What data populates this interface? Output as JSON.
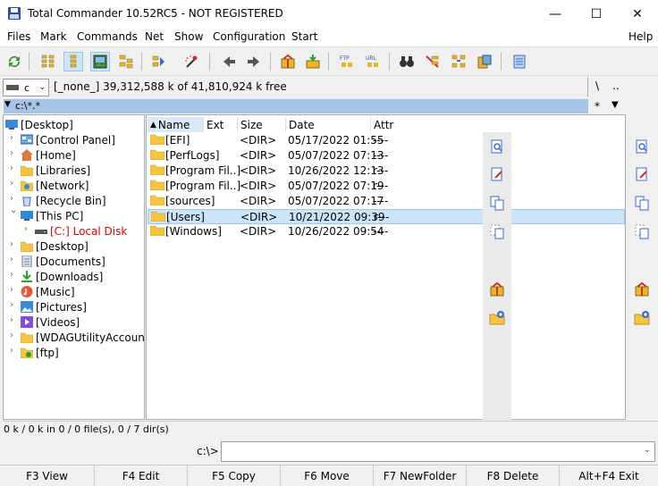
{
  "window": {
    "title": "Total Commander 10.52RC5 - NOT REGISTERED",
    "minimize": "—",
    "maximize": "☐",
    "close": "✕"
  },
  "menu": [
    "Files",
    "Mark",
    "Commands",
    "Net",
    "Show",
    "Configuration",
    "Start",
    "Help"
  ],
  "drive": {
    "letter": "c",
    "info": "[_none_]  39,312,588 k of 41,810,924 k free",
    "root_btn": "\\",
    "up_btn": ".."
  },
  "path": {
    "value": "c:\\*.*",
    "filter": "*"
  },
  "tree": [
    {
      "label": "[Desktop]",
      "icon": "desktop-icon",
      "level": 0,
      "chev": ""
    },
    {
      "label": "[Control Panel]",
      "icon": "control-panel-icon",
      "level": 1,
      "chev": ">"
    },
    {
      "label": "[Home]",
      "icon": "home-icon",
      "level": 1,
      "chev": ">"
    },
    {
      "label": "[Libraries]",
      "icon": "folder-icon",
      "level": 1,
      "chev": ">"
    },
    {
      "label": "[Network]",
      "icon": "network-icon",
      "level": 1,
      "chev": ">"
    },
    {
      "label": "[Recycle Bin]",
      "icon": "recycle-bin-icon",
      "level": 1,
      "chev": ">"
    },
    {
      "label": "[This PC]",
      "icon": "pc-icon",
      "level": 1,
      "chev": "v"
    },
    {
      "label": "[C:]  Local Disk",
      "icon": "drive-icon",
      "level": 2,
      "chev": ">"
    },
    {
      "label": "[Desktop]",
      "icon": "folder-icon",
      "level": 1,
      "chev": ">"
    },
    {
      "label": "[Documents]",
      "icon": "documents-icon",
      "level": 1,
      "chev": ">"
    },
    {
      "label": "[Downloads]",
      "icon": "downloads-icon",
      "level": 1,
      "chev": ">"
    },
    {
      "label": "[Music]",
      "icon": "music-icon",
      "level": 1,
      "chev": ">"
    },
    {
      "label": "[Pictures]",
      "icon": "pictures-icon",
      "level": 1,
      "chev": ">"
    },
    {
      "label": "[Videos]",
      "icon": "videos-icon",
      "level": 1,
      "chev": ">"
    },
    {
      "label": "[WDAGUtilityAccount]",
      "icon": "folder-icon",
      "level": 1,
      "chev": ">"
    },
    {
      "label": "[ftp]",
      "icon": "ftp-icon",
      "level": 1,
      "chev": ">"
    }
  ],
  "columns": {
    "name": "Name",
    "ext": "Ext",
    "size": "Size",
    "date": "Date",
    "attr": "Attr"
  },
  "files": [
    {
      "name": "[EFI]",
      "size": "<DIR>",
      "date": "05/17/2022 01:55",
      "attr": "----"
    },
    {
      "name": "[PerfLogs]",
      "size": "<DIR>",
      "date": "05/07/2022 07:13",
      "attr": "----"
    },
    {
      "name": "[Program Fil..]",
      "size": "<DIR>",
      "date": "10/26/2022 12:13",
      "attr": "r---"
    },
    {
      "name": "[Program Fil..]",
      "size": "<DIR>",
      "date": "05/07/2022 07:19",
      "attr": "r---"
    },
    {
      "name": "[sources]",
      "size": "<DIR>",
      "date": "05/07/2022 07:17",
      "attr": "----"
    },
    {
      "name": "[Users]",
      "size": "<DIR>",
      "date": "10/21/2022 09:39",
      "attr": "r---"
    },
    {
      "name": "[Windows]",
      "size": "<DIR>",
      "date": "10/26/2022 09:54",
      "attr": "----"
    }
  ],
  "status": "0 k / 0 k in 0 / 0 file(s), 0 / 7 dir(s)",
  "cmdline": {
    "label": "c:\\>"
  },
  "fkeys": [
    "F3 View",
    "F4 Edit",
    "F5 Copy",
    "F6 Move",
    "F7 NewFolder",
    "F8 Delete",
    "Alt+F4 Exit"
  ],
  "colors": {
    "path_bar": "#a6c4e6",
    "selection": "#cce4f7",
    "local_disk": "#e00000",
    "folder": "#f5c542"
  }
}
